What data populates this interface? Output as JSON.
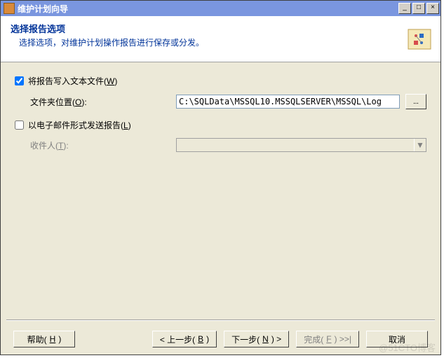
{
  "window": {
    "title": "维护计划向导"
  },
  "header": {
    "title": "选择报告选项",
    "subtitle": "选择选项，对维护计划操作报告进行保存或分发。"
  },
  "form": {
    "write_to_file": {
      "label_prefix": "将报告写入文本文件(",
      "hotkey": "W",
      "label_suffix": ")",
      "checked": true
    },
    "folder": {
      "label_prefix": "文件夹位置(",
      "hotkey": "O",
      "label_suffix": "):",
      "value": "C:\\SQLData\\MSSQL10.MSSQLSERVER\\MSSQL\\Log",
      "browse": "..."
    },
    "email_report": {
      "label_prefix": "以电子邮件形式发送报告(",
      "hotkey": "L",
      "label_suffix": ")",
      "checked": false
    },
    "recipient": {
      "label_prefix": "收件人(",
      "hotkey": "T",
      "label_suffix": "):",
      "value": ""
    }
  },
  "buttons": {
    "help": {
      "prefix": "帮助(",
      "hotkey": "H",
      "suffix": ")"
    },
    "back": {
      "prefix": "< 上一步(",
      "hotkey": "B",
      "suffix": ")"
    },
    "next": {
      "prefix": "下一步(",
      "hotkey": "N",
      "suffix": ") >"
    },
    "finish": {
      "prefix": "完成(",
      "hotkey": "F",
      "suffix": ") >>|"
    },
    "cancel": "取消"
  },
  "watermark": "@51CTO博客"
}
